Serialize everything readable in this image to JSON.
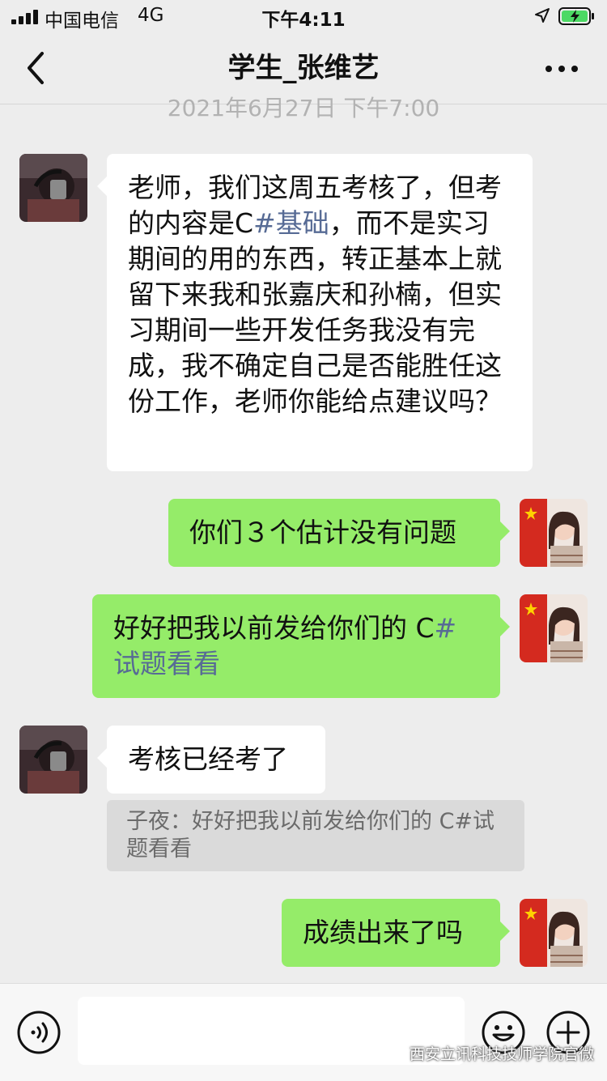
{
  "status_bar": {
    "carrier": "中国电信",
    "network": "4G",
    "time": "下午4:11",
    "battery_icon": "battery-charging-icon",
    "location_icon": "location-arrow-icon"
  },
  "nav": {
    "back_icon": "chevron-left-icon",
    "title": "学生_张维艺",
    "more_icon": "more-dots-icon"
  },
  "chat": {
    "timestamp": "2021年6月27日 下午7:00",
    "messages": [
      {
        "sender": "student",
        "text": "老师，我们这周五考核了，但考的内容是C#基础，而不是实习期间的用的东西，转正基本上就留下来我和张嘉庆和孙楠，但实习期间一些开发任务我没有完成，我不确定自己是否能胜任这份工作，老师你能给点建议吗？"
      },
      {
        "sender": "teacher",
        "text": "你们３个估计没有问题"
      },
      {
        "sender": "teacher",
        "text": "好好把我以前发给你们的 C#试题看看"
      },
      {
        "sender": "student",
        "text": "考核已经考了"
      },
      {
        "sender": "teacher",
        "text": "成绩出来了吗"
      }
    ],
    "quote": {
      "author": "子夜",
      "separator": "：",
      "text": "好好把我以前发给你们的 C#试题看看"
    }
  },
  "input_bar": {
    "voice_icon": "voice-icon",
    "input_value": "",
    "emoji_icon": "emoji-icon",
    "plus_icon": "plus-icon"
  },
  "watermark": {
    "text": "西安立讯科技技师学院官微"
  },
  "colors": {
    "background": "#ededed",
    "outgoing_bubble": "#95ec69",
    "incoming_bubble": "#ffffff",
    "hashtag": "#576b95"
  }
}
